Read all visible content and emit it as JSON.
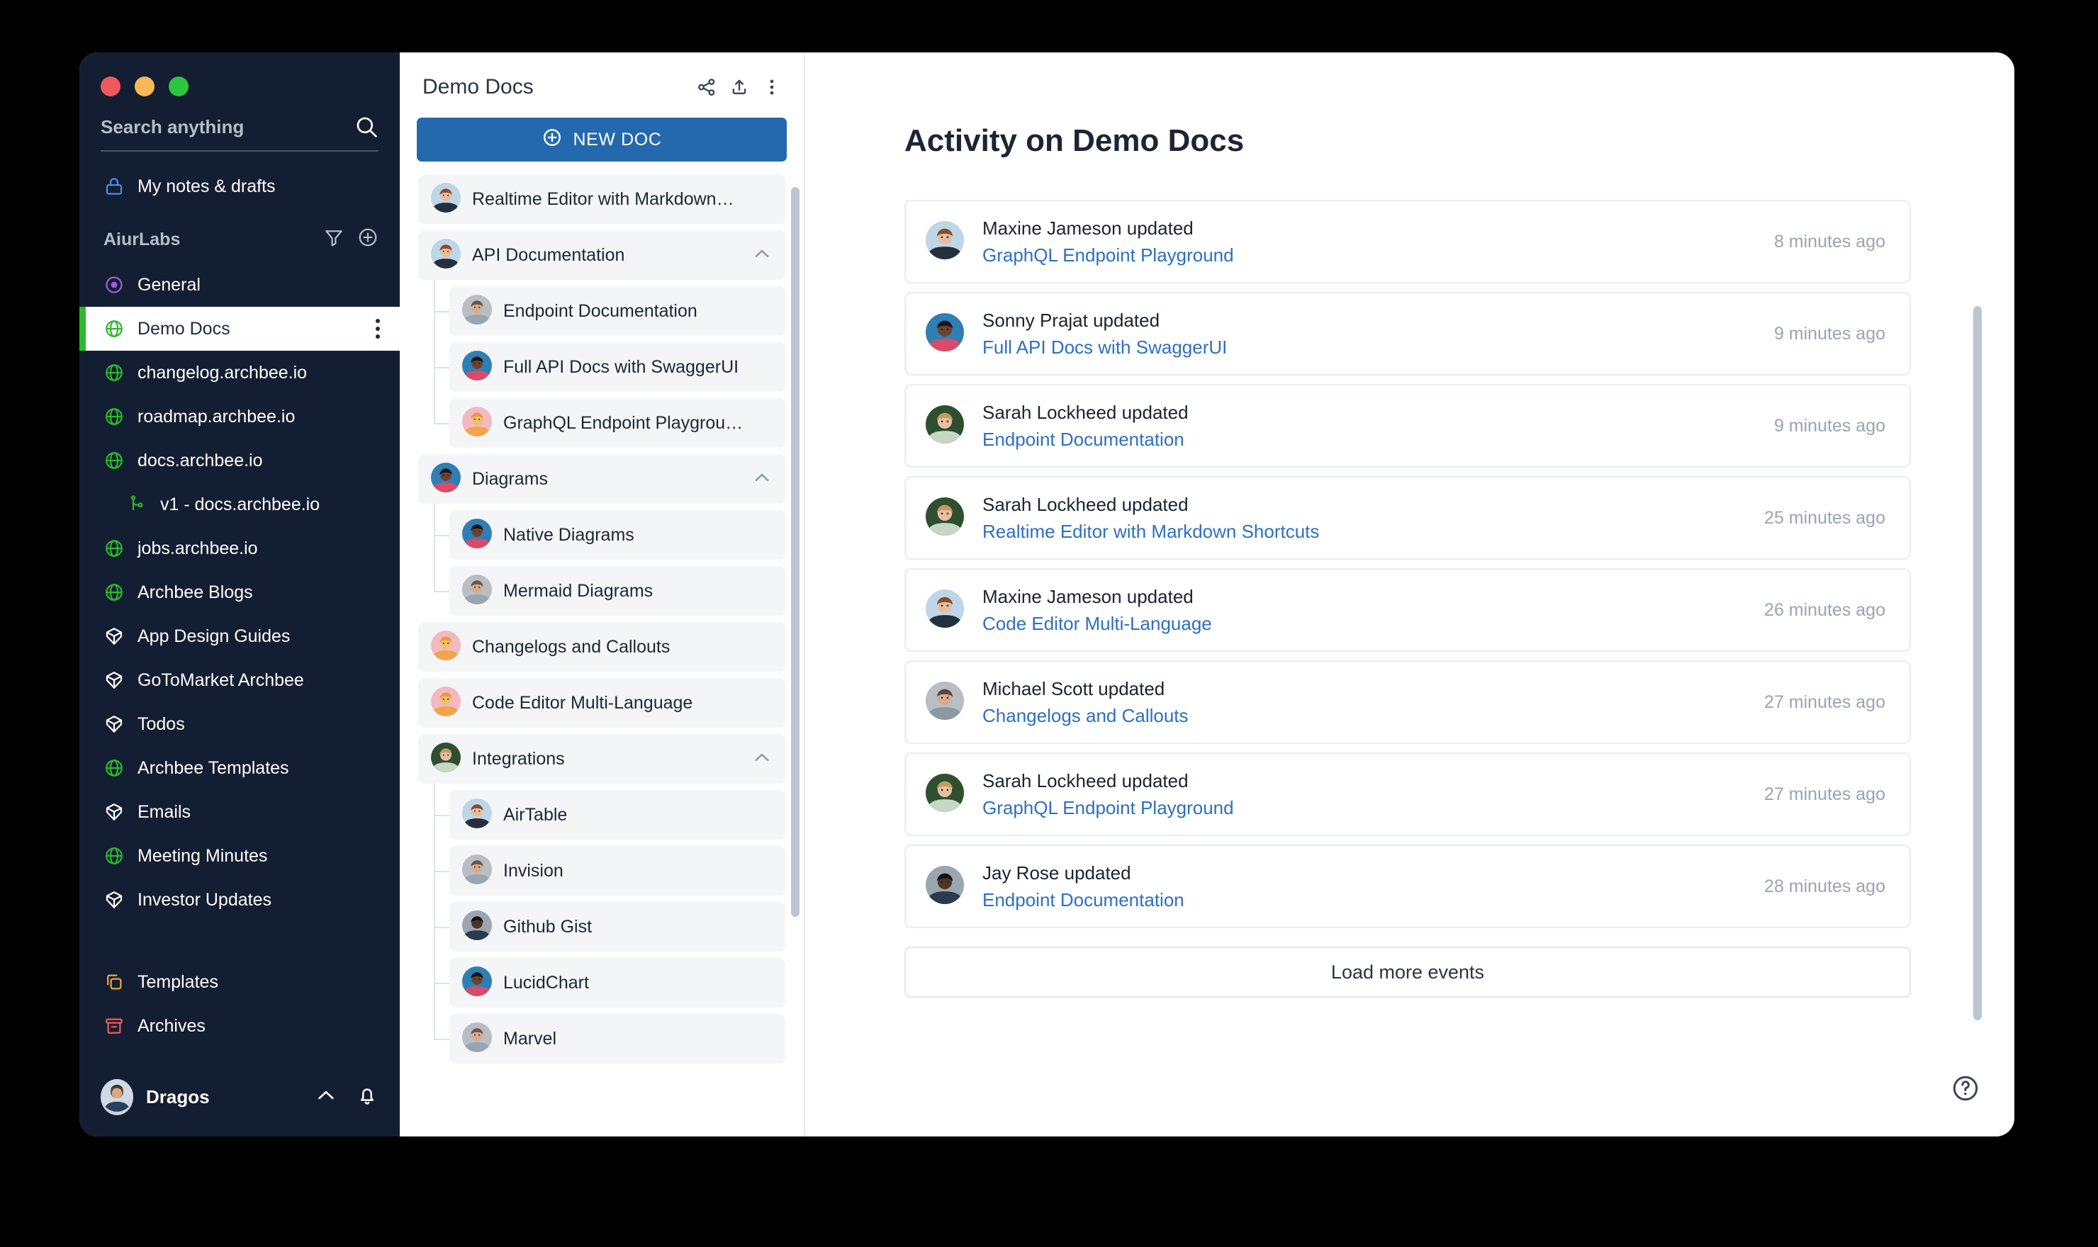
{
  "window": {
    "traffic_lights": [
      "close",
      "minimize",
      "maximize"
    ]
  },
  "sidebar": {
    "search": {
      "placeholder": "Search anything",
      "value": ""
    },
    "my_notes": {
      "label": "My notes & drafts",
      "icon": "lock-icon"
    },
    "workspace": {
      "label": "AiurLabs",
      "filter_icon": "filter-icon",
      "add_icon": "plus-circle-icon"
    },
    "spaces": [
      {
        "label": "General",
        "icon": "target-icon",
        "indent": false,
        "active": false
      },
      {
        "label": "Demo Docs",
        "icon": "globe-icon",
        "indent": false,
        "active": true
      },
      {
        "label": "changelog.archbee.io",
        "icon": "globe-icon",
        "indent": false,
        "active": false
      },
      {
        "label": "roadmap.archbee.io",
        "icon": "globe-icon",
        "indent": false,
        "active": false
      },
      {
        "label": "docs.archbee.io",
        "icon": "globe-icon",
        "indent": false,
        "active": false
      },
      {
        "label": "v1 - docs.archbee.io",
        "icon": "branch-icon",
        "indent": true,
        "active": false
      },
      {
        "label": "jobs.archbee.io",
        "icon": "globe-icon",
        "indent": false,
        "active": false
      },
      {
        "label": "Archbee Blogs",
        "icon": "globe-icon",
        "indent": false,
        "active": false
      },
      {
        "label": "App Design Guides",
        "icon": "cube-icon",
        "indent": false,
        "active": false
      },
      {
        "label": "GoToMarket Archbee",
        "icon": "cube-icon",
        "indent": false,
        "active": false
      },
      {
        "label": "Todos",
        "icon": "cube-icon",
        "indent": false,
        "active": false
      },
      {
        "label": "Archbee Templates",
        "icon": "globe-icon",
        "indent": false,
        "active": false
      },
      {
        "label": "Emails",
        "icon": "cube-icon",
        "indent": false,
        "active": false
      },
      {
        "label": "Meeting Minutes",
        "icon": "globe-icon",
        "indent": false,
        "active": false
      },
      {
        "label": "Investor Updates",
        "icon": "cube-icon",
        "indent": false,
        "active": false
      }
    ],
    "bottom_items": [
      {
        "label": "Templates",
        "icon": "copy-icon"
      },
      {
        "label": "Archives",
        "icon": "archive-icon"
      }
    ],
    "user": {
      "name": "Dragos",
      "collapse_icon": "chevron-up-icon",
      "bell_icon": "bell-icon"
    }
  },
  "tree": {
    "title": "Demo Docs",
    "header_icons": [
      "share-icon",
      "upload-icon",
      "more-vertical-icon"
    ],
    "new_doc_label": "NEW DOC",
    "items": [
      {
        "label": "Realtime Editor with Markdown…",
        "level": 0,
        "expandable": false
      },
      {
        "label": "API Documentation",
        "level": 0,
        "expandable": true
      },
      {
        "label": "Endpoint Documentation",
        "level": 1,
        "expandable": false
      },
      {
        "label": "Full API Docs with SwaggerUI",
        "level": 1,
        "expandable": false
      },
      {
        "label": "GraphQL Endpoint Playgrou…",
        "level": 1,
        "expandable": false
      },
      {
        "label": "Diagrams",
        "level": 0,
        "expandable": true
      },
      {
        "label": "Native Diagrams",
        "level": 1,
        "expandable": false
      },
      {
        "label": "Mermaid Diagrams",
        "level": 1,
        "expandable": false
      },
      {
        "label": "Changelogs and Callouts",
        "level": 0,
        "expandable": false
      },
      {
        "label": "Code Editor Multi-Language",
        "level": 0,
        "expandable": false
      },
      {
        "label": "Integrations",
        "level": 0,
        "expandable": true
      },
      {
        "label": "AirTable",
        "level": 1,
        "expandable": false
      },
      {
        "label": "Invision",
        "level": 1,
        "expandable": false
      },
      {
        "label": "Github Gist",
        "level": 1,
        "expandable": false
      },
      {
        "label": "LucidChart",
        "level": 1,
        "expandable": false
      },
      {
        "label": "Marvel",
        "level": 1,
        "expandable": false
      }
    ]
  },
  "activity": {
    "title": "Activity on Demo Docs",
    "action_verb": "updated",
    "events": [
      {
        "user": "Maxine Jameson updated",
        "doc": "GraphQL Endpoint Playground",
        "time": "8 minutes ago"
      },
      {
        "user": "Sonny Prajat updated",
        "doc": "Full API Docs with SwaggerUI",
        "time": "9 minutes ago"
      },
      {
        "user": "Sarah Lockheed updated",
        "doc": "Endpoint Documentation",
        "time": "9 minutes ago"
      },
      {
        "user": "Sarah Lockheed updated",
        "doc": "Realtime Editor with Markdown Shortcuts",
        "time": "25 minutes ago"
      },
      {
        "user": "Maxine Jameson updated",
        "doc": "Code Editor Multi-Language",
        "time": "26 minutes ago"
      },
      {
        "user": "Michael Scott updated",
        "doc": "Changelogs and Callouts",
        "time": "27 minutes ago"
      },
      {
        "user": "Sarah Lockheed updated",
        "doc": "GraphQL Endpoint Playground",
        "time": "27 minutes ago"
      },
      {
        "user": "Jay Rose updated",
        "doc": "Endpoint Documentation",
        "time": "28 minutes ago"
      }
    ],
    "load_more_label": "Load more events",
    "help_icon": "help-circle-icon"
  },
  "colors": {
    "sidebar_bg": "#141e32",
    "accent_green": "#2cb82c",
    "primary_blue": "#2469ae",
    "link_blue": "#2d6fc2",
    "muted": "#9aa4b2"
  }
}
